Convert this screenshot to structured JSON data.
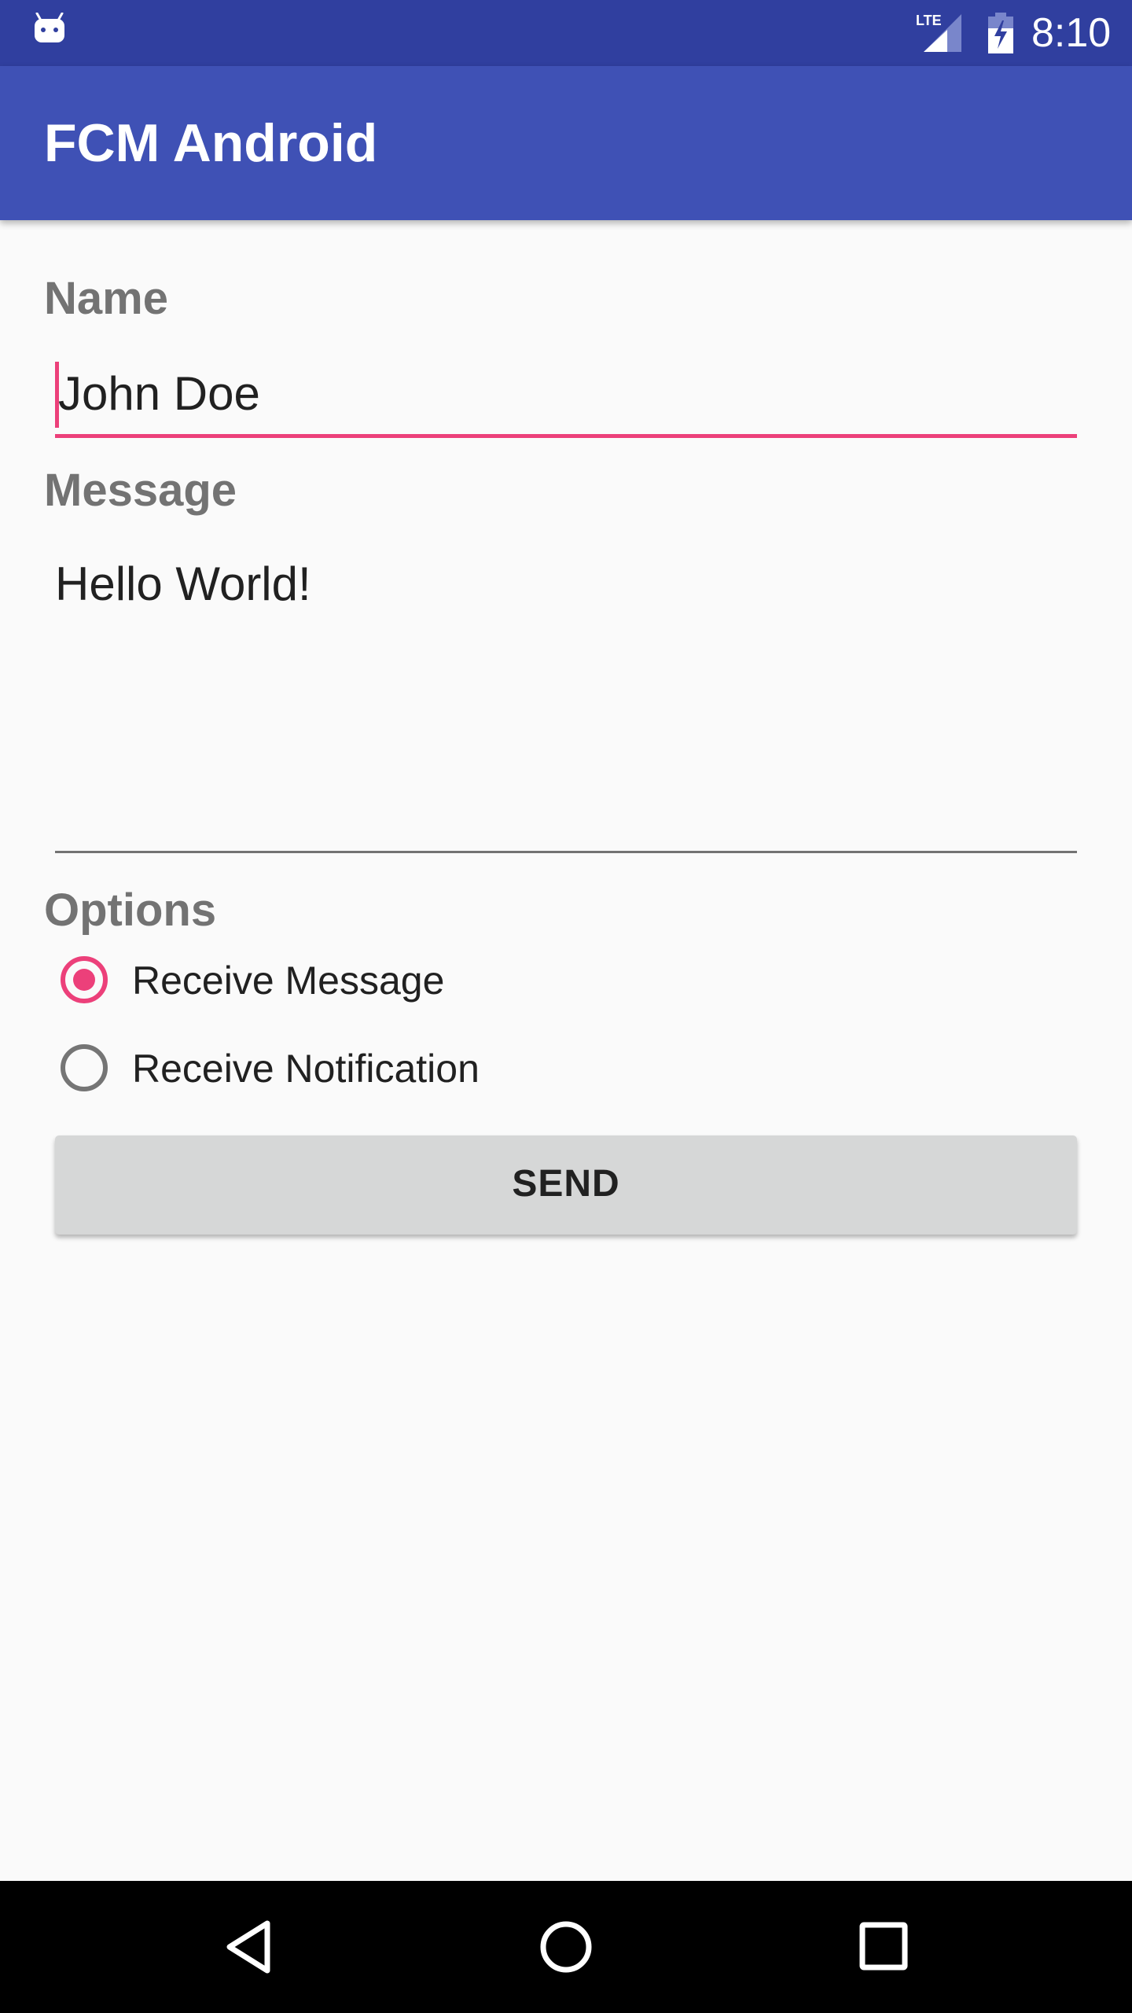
{
  "status_bar": {
    "left_icon": "android-icon",
    "network_label": "LTE",
    "network_icon": "cell-signal-icon",
    "battery_icon": "battery-charging-icon",
    "time": "8:10"
  },
  "app_bar": {
    "title": "FCM Android",
    "color": "#3f51b5",
    "status_color": "#303f9f"
  },
  "form": {
    "name": {
      "label": "Name",
      "value": "John Doe",
      "focused": true
    },
    "message": {
      "label": "Message",
      "value": "Hello World!"
    },
    "options": {
      "label": "Options",
      "choices": [
        {
          "label": "Receive Message",
          "checked": true
        },
        {
          "label": "Receive Notification",
          "checked": false
        }
      ]
    },
    "send_button": {
      "label": "SEND"
    }
  },
  "colors": {
    "accent": "#ec407a",
    "background": "#fafafa",
    "button": "#d6d7d7"
  },
  "nav_bar": {
    "back_icon": "back-triangle-icon",
    "home_icon": "home-circle-icon",
    "recent_icon": "recent-apps-square-icon"
  }
}
